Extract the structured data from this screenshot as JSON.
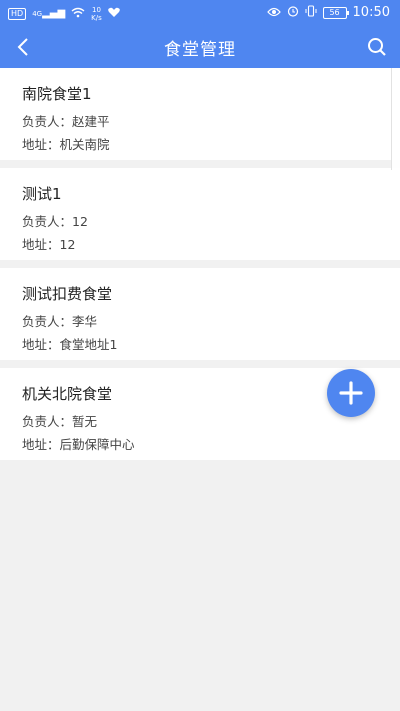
{
  "statusbar": {
    "hd_badge": "HD",
    "signal_label": "4G",
    "speed_value": "10",
    "speed_unit": "K/s",
    "battery": "56",
    "time": "10:50"
  },
  "navbar": {
    "title": "食堂管理",
    "back_icon": "chevron-left-icon",
    "search_icon": "search-icon"
  },
  "canteens": [
    {
      "name": "南院食堂1",
      "manager": "负责人：赵建平",
      "address": "地址：机关南院"
    },
    {
      "name": "测试1",
      "manager": "负责人：12",
      "address": "地址：12"
    },
    {
      "name": "测试扣费食堂",
      "manager": "负责人：李华",
      "address": "地址：食堂地址1"
    },
    {
      "name": "机关北院食堂",
      "manager": "负责人：暂无",
      "address": "地址：后勤保障中心"
    }
  ],
  "fab": {
    "icon": "plus-icon"
  },
  "colors": {
    "primary": "#4f86f0",
    "background": "#f1f1f1"
  }
}
